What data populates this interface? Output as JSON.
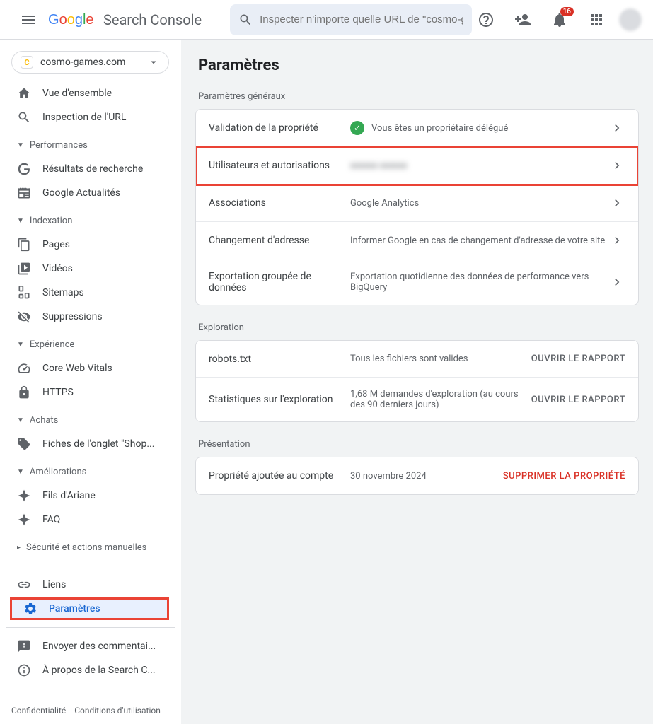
{
  "header": {
    "product_name": "Search Console",
    "search_placeholder": "Inspecter n'importe quelle URL de \"cosmo-games.com\"",
    "notification_count": "16"
  },
  "property": {
    "name": "cosmo-games.com"
  },
  "sidebar": {
    "overview": "Vue d'ensemble",
    "url_inspection": "Inspection de l'URL",
    "sections": {
      "performances": "Performances",
      "indexation": "Indexation",
      "experience": "Expérience",
      "achats": "Achats",
      "ameliorations": "Améliorations",
      "securite": "Sécurité et actions manuelles"
    },
    "items": {
      "search_results": "Résultats de recherche",
      "google_news": "Google Actualités",
      "pages": "Pages",
      "videos": "Vidéos",
      "sitemaps": "Sitemaps",
      "removals": "Suppressions",
      "cwv": "Core Web Vitals",
      "https": "HTTPS",
      "shopping": "Fiches de l'onglet \"Shop...",
      "breadcrumbs": "Fils d'Ariane",
      "faq": "FAQ",
      "links": "Liens",
      "settings": "Paramètres",
      "feedback": "Envoyer des commentai...",
      "about": "À propos de la Search C..."
    }
  },
  "footer": {
    "privacy": "Confidentialité",
    "terms": "Conditions d'utilisation"
  },
  "main": {
    "title": "Paramètres",
    "general": {
      "label": "Paramètres généraux",
      "ownership": {
        "label": "Validation de la propriété",
        "value": "Vous êtes un propriétaire délégué"
      },
      "users": {
        "label": "Utilisateurs et autorisations"
      },
      "associations": {
        "label": "Associations",
        "value": "Google Analytics"
      },
      "address": {
        "label": "Changement d'adresse",
        "value": "Informer Google en cas de changement d'adresse de votre site"
      },
      "export": {
        "label": "Exportation groupée de données",
        "value": "Exportation quotidienne des données de performance vers BigQuery"
      }
    },
    "crawling": {
      "label": "Exploration",
      "robots": {
        "label": "robots.txt",
        "value": "Tous les fichiers sont valides",
        "action": "OUVRIR LE RAPPORT"
      },
      "stats": {
        "label": "Statistiques sur l'exploration",
        "value": "1,68 M demandes d'exploration (au cours des 90 derniers jours)",
        "action": "OUVRIR LE RAPPORT"
      }
    },
    "presentation": {
      "label": "Présentation",
      "added": {
        "label": "Propriété ajoutée au compte",
        "value": "30 novembre 2024",
        "action": "SUPPRIMER LA PROPRIÉTÉ"
      }
    }
  }
}
